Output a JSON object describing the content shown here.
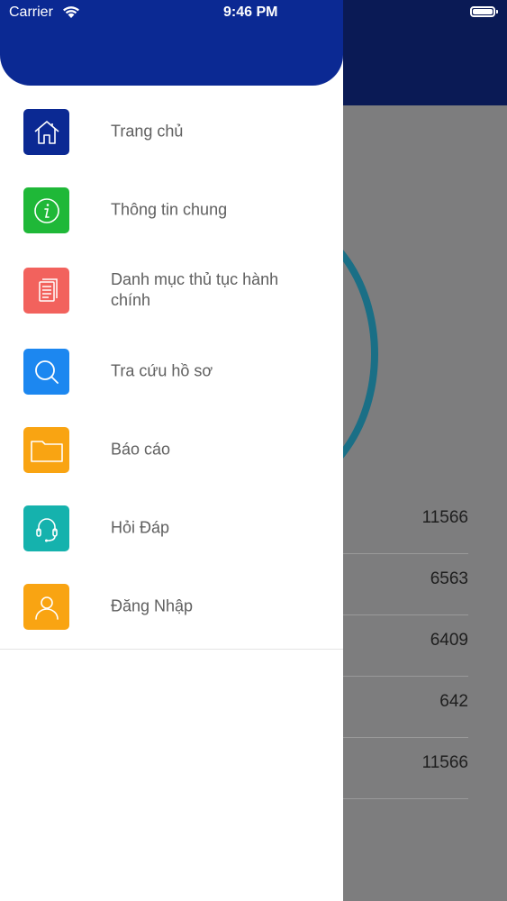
{
  "status_bar": {
    "carrier": "Carrier",
    "time": "9:46 PM"
  },
  "menu": {
    "items": [
      {
        "label": "Trang chủ",
        "icon": "home-icon",
        "color": "#0b2993"
      },
      {
        "label": "Thông tin chung",
        "icon": "info-icon",
        "color": "#1fb838"
      },
      {
        "label": "Danh mục thủ tục hành chính",
        "icon": "document-icon",
        "color": "#f2625d"
      },
      {
        "label": "Tra cứu hồ sơ",
        "icon": "search-icon",
        "color": "#1c87f0"
      },
      {
        "label": "Báo cáo",
        "icon": "folder-icon",
        "color": "#f9a412"
      },
      {
        "label": "Hỏi Đáp",
        "icon": "headset-icon",
        "color": "#15b2ad"
      },
      {
        "label": "Đăng Nhập",
        "icon": "user-icon",
        "color": "#f9a412"
      }
    ]
  },
  "background": {
    "stats": [
      "11566",
      "6563",
      "6409",
      "642",
      "11566"
    ]
  }
}
